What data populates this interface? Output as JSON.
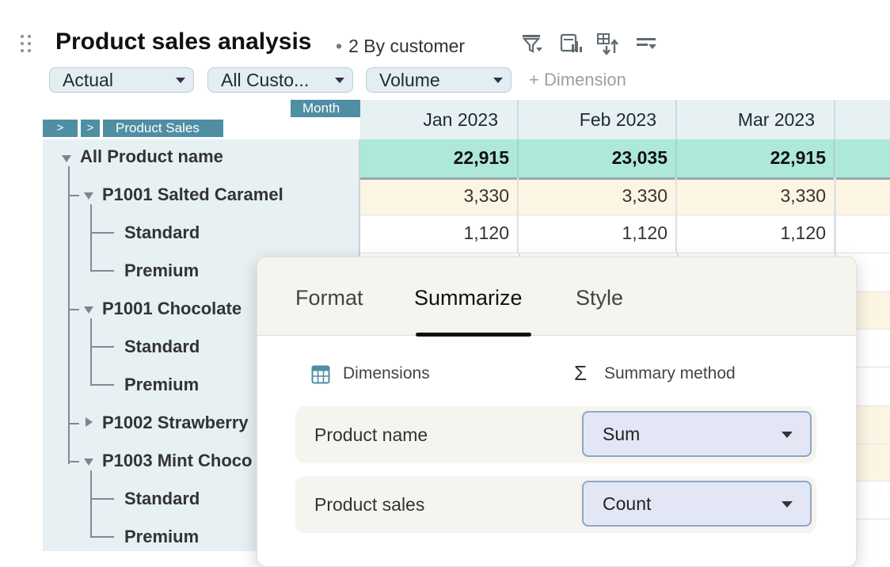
{
  "header": {
    "title": "Product sales analysis",
    "subtitle_dot": "•",
    "subtitle": "2 By customer",
    "tools": [
      "filter-icon",
      "report-icon",
      "pivot-swap-icon",
      "sort-icon"
    ]
  },
  "filters": [
    {
      "value": "Actual"
    },
    {
      "value": "All Custo..."
    },
    {
      "value": "Volume"
    }
  ],
  "add_dimension": "+ Dimension",
  "grid": {
    "month_tag": "Month",
    "product_sales_tag": "Product Sales",
    "chevron": ">",
    "columns": [
      "Jan 2023",
      "Feb 2023",
      "Mar 2023"
    ],
    "rows": [
      {
        "label": "All Product name",
        "level": 0,
        "expander": "down",
        "values": [
          "22,915",
          "23,035",
          "22,915"
        ],
        "kind": "total"
      },
      {
        "label": "P1001 Salted Caramel",
        "level": 1,
        "expander": "down",
        "values": [
          "3,330",
          "3,330",
          "3,330"
        ],
        "kind": "group"
      },
      {
        "label": "Standard",
        "level": 2,
        "expander": "",
        "values": [
          "1,120",
          "1,120",
          "1,120"
        ],
        "kind": "leaf"
      },
      {
        "label": "Premium",
        "level": 2,
        "expander": "",
        "values": [],
        "kind": "leaf"
      },
      {
        "label": "P1001 Chocolate",
        "level": 1,
        "expander": "down",
        "values": [],
        "kind": "group"
      },
      {
        "label": "Standard",
        "level": 2,
        "expander": "",
        "values": [],
        "kind": "leaf"
      },
      {
        "label": "Premium",
        "level": 2,
        "expander": "",
        "values": [],
        "kind": "leaf"
      },
      {
        "label": "P1002 Strawberry",
        "level": 1,
        "expander": "right",
        "values": [],
        "kind": "group"
      },
      {
        "label": "P1003 Mint Choco",
        "level": 1,
        "expander": "down",
        "values": [],
        "kind": "group"
      },
      {
        "label": "Standard",
        "level": 2,
        "expander": "",
        "values": [],
        "kind": "leaf"
      },
      {
        "label": "Premium",
        "level": 2,
        "expander": "",
        "values": [],
        "kind": "leaf"
      }
    ]
  },
  "popover": {
    "tabs": [
      "Format",
      "Summarize",
      "Style"
    ],
    "active_tab": "Summarize",
    "dimensions_header": "Dimensions",
    "summary_header": "Summary method",
    "sigma": "Σ",
    "rows": [
      {
        "label": "Product name",
        "method": "Sum"
      },
      {
        "label": "Product sales",
        "method": "Count"
      }
    ]
  },
  "colors": {
    "total_row": "#ade8d8",
    "group_row": "#fdf5e3",
    "header_bg": "#e7f0f3",
    "tag": "#4f8ea3"
  }
}
